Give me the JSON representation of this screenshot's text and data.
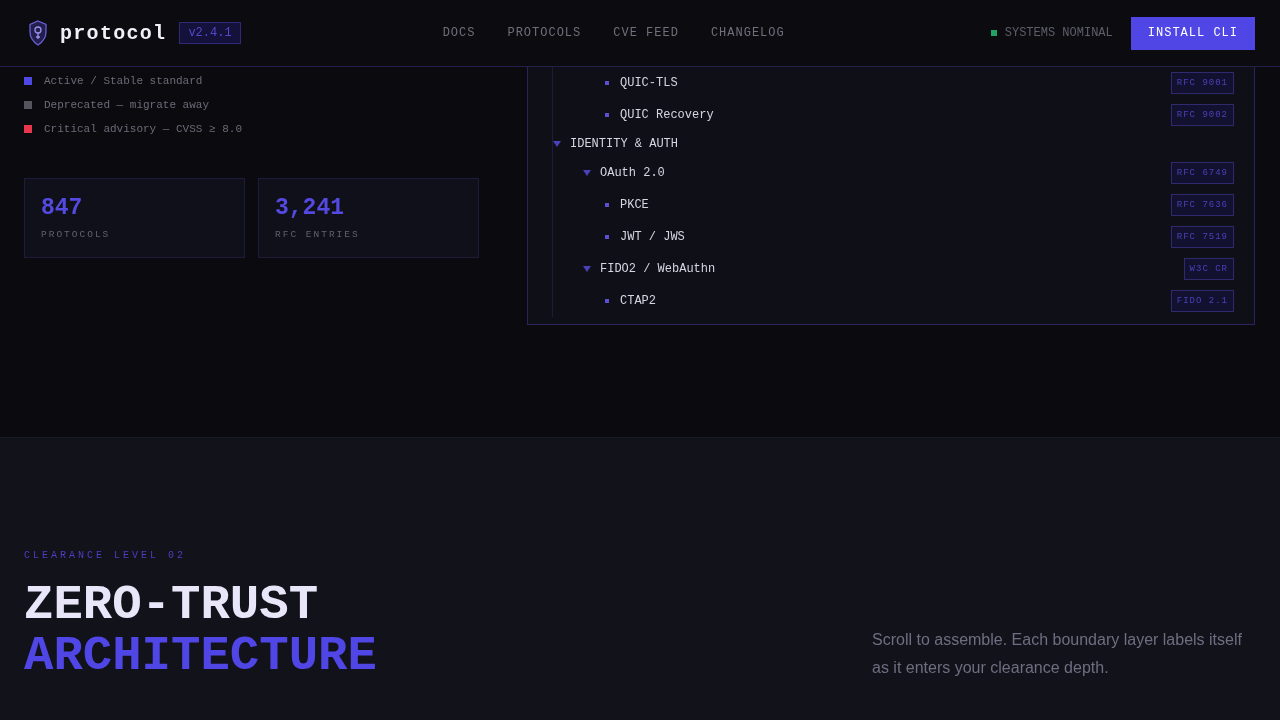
{
  "header": {
    "logo": "protocol",
    "version": "v2.4.1",
    "nav": [
      {
        "label": "DOCS"
      },
      {
        "label": "PROTOCOLS"
      },
      {
        "label": "CVE FEED"
      },
      {
        "label": "CHANGELOG"
      }
    ],
    "status": "SYSTEMS NOMINAL",
    "cta": "INSTALL CLI"
  },
  "legend": [
    {
      "label": "Active / Stable standard",
      "color": "#5048e5"
    },
    {
      "label": "Deprecated — migrate away",
      "color": "#55555e"
    },
    {
      "label": "Critical advisory — CVSS ≥ 8.0",
      "color": "#e8364f"
    }
  ],
  "stats": [
    {
      "value": "847",
      "label": "PROTOCOLS"
    },
    {
      "value": "3,241",
      "label": "RFC ENTRIES"
    }
  ],
  "tree": [
    {
      "children": [
        {
          "children": [
            {
              "label": "QUIC-TLS",
              "badge": "RFC 9001"
            },
            {
              "label": "QUIC Recovery",
              "badge": "RFC 9002"
            }
          ]
        }
      ]
    },
    {
      "label": "IDENTITY & AUTH",
      "expanded": true,
      "children": [
        {
          "label": "OAuth 2.0",
          "badge": "RFC 6749",
          "expanded": true,
          "children": [
            {
              "label": "PKCE",
              "badge": "RFC 7636"
            },
            {
              "label": "JWT / JWS",
              "badge": "RFC 7519"
            }
          ]
        },
        {
          "label": "FIDO2 / WebAuthn",
          "badge": "W3C CR",
          "expanded": true,
          "children": [
            {
              "label": "CTAP2",
              "badge": "FIDO 2.1"
            }
          ]
        }
      ]
    }
  ],
  "hero": {
    "eyebrow": "CLEARANCE LEVEL 02",
    "title_lines": [
      "ZERO-TRUST",
      "ARCHITECTURE"
    ],
    "description": "Scroll to assemble. Each boundary layer labels itself as it enters your clearance depth."
  }
}
